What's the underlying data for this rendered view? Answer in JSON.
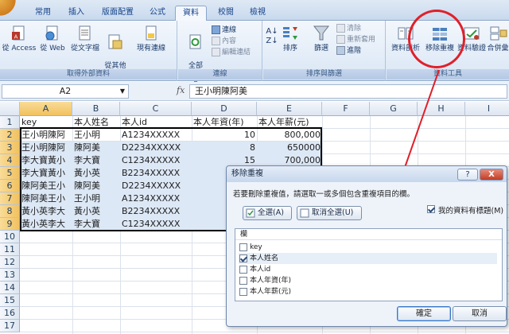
{
  "ribbon": {
    "tabs": [
      "常用",
      "插入",
      "版面配置",
      "公式",
      "資料",
      "校閱",
      "檢視"
    ],
    "active_tab": "資料",
    "groups": {
      "external": {
        "label": "取得外部資料",
        "access": "從 Access",
        "web": "從 Web",
        "text": "從文字檔",
        "other": "從其他\n來源 ▾",
        "existing": "現有連線"
      },
      "connections": {
        "label": "連線",
        "refresh": "全部\n重新整理 ▾",
        "conn": "連線",
        "props": "內容",
        "edit": "編輯連結"
      },
      "sort": {
        "label": "排序與篩選",
        "sort": "排序",
        "filter": "篩選",
        "clear": "清除",
        "reapply": "重新套用",
        "advanced": "進階"
      },
      "tools": {
        "label": "資料工具",
        "text_to_cols": "資料剖析",
        "remove_dup": "移除重複",
        "validation": "資料驗證",
        "consolidate": "合併彙"
      }
    },
    "colors": {
      "highlight": "#e0202a"
    }
  },
  "formula_bar": {
    "cell_ref": "A2",
    "fx": "fx",
    "value": "王小明陳阿美"
  },
  "grid": {
    "columns": [
      "A",
      "B",
      "C",
      "D",
      "E",
      "F",
      "G",
      "H",
      "I"
    ],
    "rows": [
      "1",
      "2",
      "3",
      "4",
      "5",
      "6",
      "7",
      "8",
      "9",
      "10",
      "11",
      "12",
      "13",
      "14",
      "15",
      "16",
      "17"
    ],
    "cells": [
      [
        "key",
        "本人姓名",
        "本人id",
        "本人年資(年)",
        "本人年薪(元)"
      ],
      [
        "王小明陳阿",
        "王小明",
        "A1234XXXXX",
        "10",
        "800,000"
      ],
      [
        "王小明陳阿",
        "陳阿美",
        "D2234XXXXX",
        "8",
        "650000"
      ],
      [
        "李大寶黃小",
        "李大寶",
        "C1234XXXXX",
        "15",
        "700,000"
      ],
      [
        "李大寶黃小",
        "黃小英",
        "B2234XXXXX",
        "",
        ""
      ],
      [
        "陳阿美王小",
        "陳阿美",
        "D2234XXXXX",
        "",
        ""
      ],
      [
        "陳阿美王小",
        "王小明",
        "A1234XXXXX",
        "",
        ""
      ],
      [
        "黃小英李大",
        "黃小英",
        "B2234XXXXX",
        "",
        ""
      ],
      [
        "黃小英李大",
        "李大寶",
        "C1234XXXXX",
        "",
        ""
      ]
    ]
  },
  "dialog": {
    "title": "移除重複",
    "help": "?",
    "close": "X",
    "instruction": "若要刪除重複值，請選取一或多個包含重複項目的欄。",
    "select_all": "全選(A)",
    "unselect_all": "取消全選(U)",
    "has_headers": "我的資料有標題(M)",
    "has_headers_checked": true,
    "list_header": "欄",
    "columns": [
      {
        "label": "key",
        "checked": false
      },
      {
        "label": "本人姓名",
        "checked": true
      },
      {
        "label": "本人id",
        "checked": false
      },
      {
        "label": "本人年資(年)",
        "checked": false
      },
      {
        "label": "本人年薪(元)",
        "checked": false
      }
    ],
    "ok": "確定",
    "cancel": "取消"
  }
}
